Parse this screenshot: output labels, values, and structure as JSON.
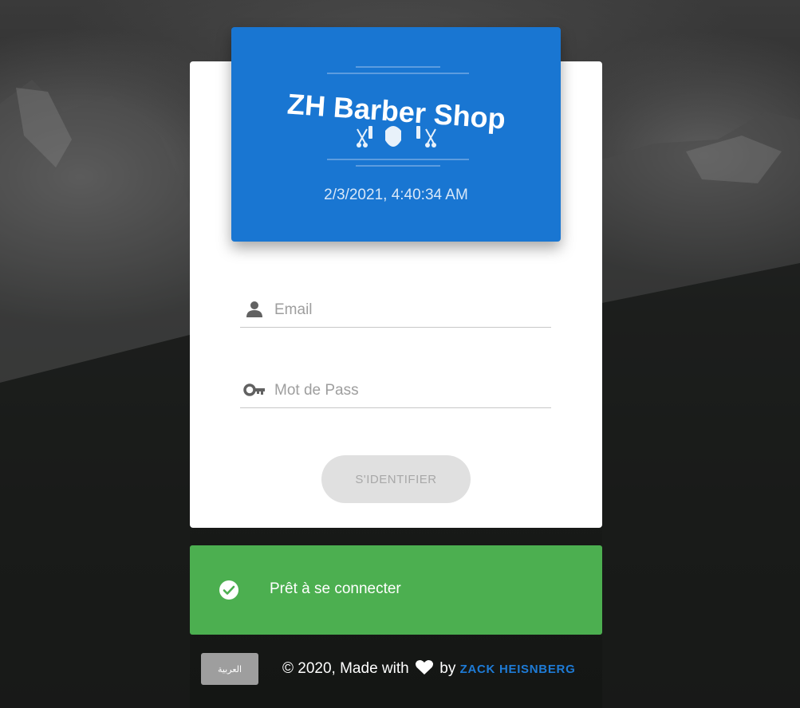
{
  "brand": {
    "logo_text": "ZH Barber Shop",
    "datetime": "2/3/2021, 4:40:34 AM",
    "color": "#1976d2"
  },
  "form": {
    "email_placeholder": "Email",
    "email_icon": "person-icon",
    "password_placeholder": "Mot de Pass",
    "password_icon": "key-icon",
    "submit_label": "S'IDENTIFIER"
  },
  "status": {
    "message": "Prêt à se connecter",
    "icon": "check-circle-icon",
    "color": "#4caf50"
  },
  "footer": {
    "language_label": "العربية",
    "copyright": "© 2020, Made with",
    "by": "by",
    "author": "ZACK HEISNBERG",
    "heart_icon": "heart-icon"
  }
}
